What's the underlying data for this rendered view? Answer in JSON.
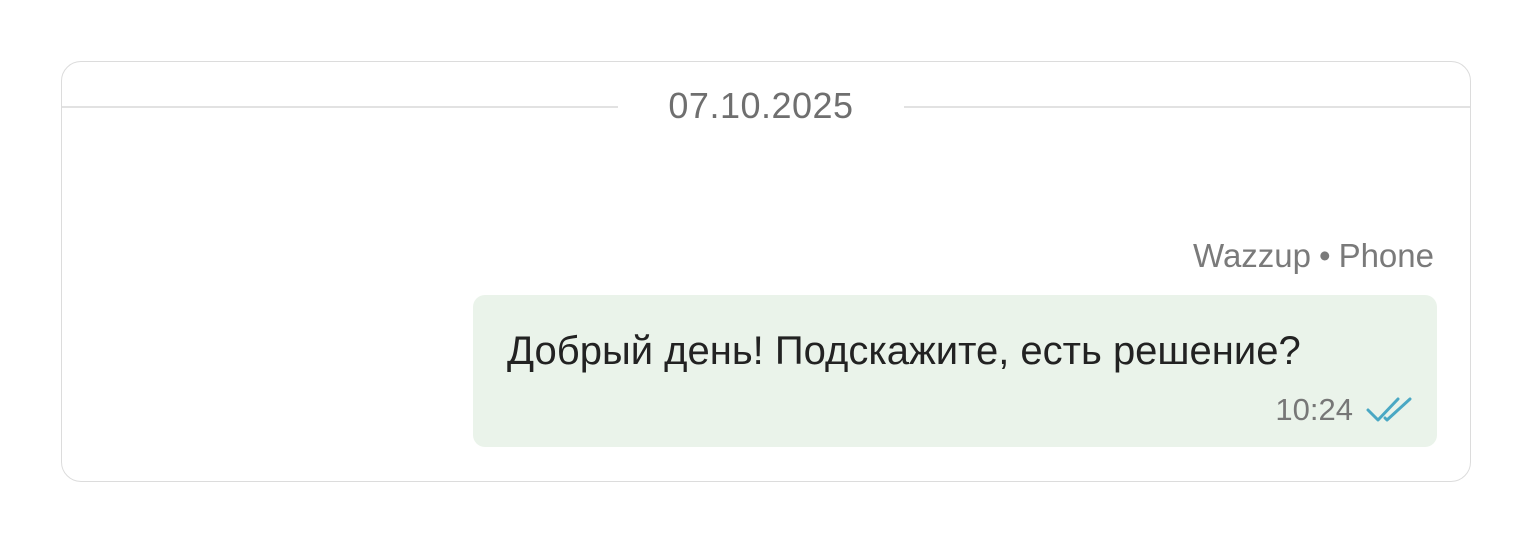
{
  "chat": {
    "date_separator": "07.10.2025",
    "message": {
      "sender": "Wazzup",
      "separator": "•",
      "channel": "Phone",
      "text": "Добрый день! Подскажите, есть решение?",
      "time": "10:24",
      "status_icon": "double-check-icon",
      "status_color": "#4aa8c4",
      "bubble_color": "#eaf3ea"
    }
  }
}
